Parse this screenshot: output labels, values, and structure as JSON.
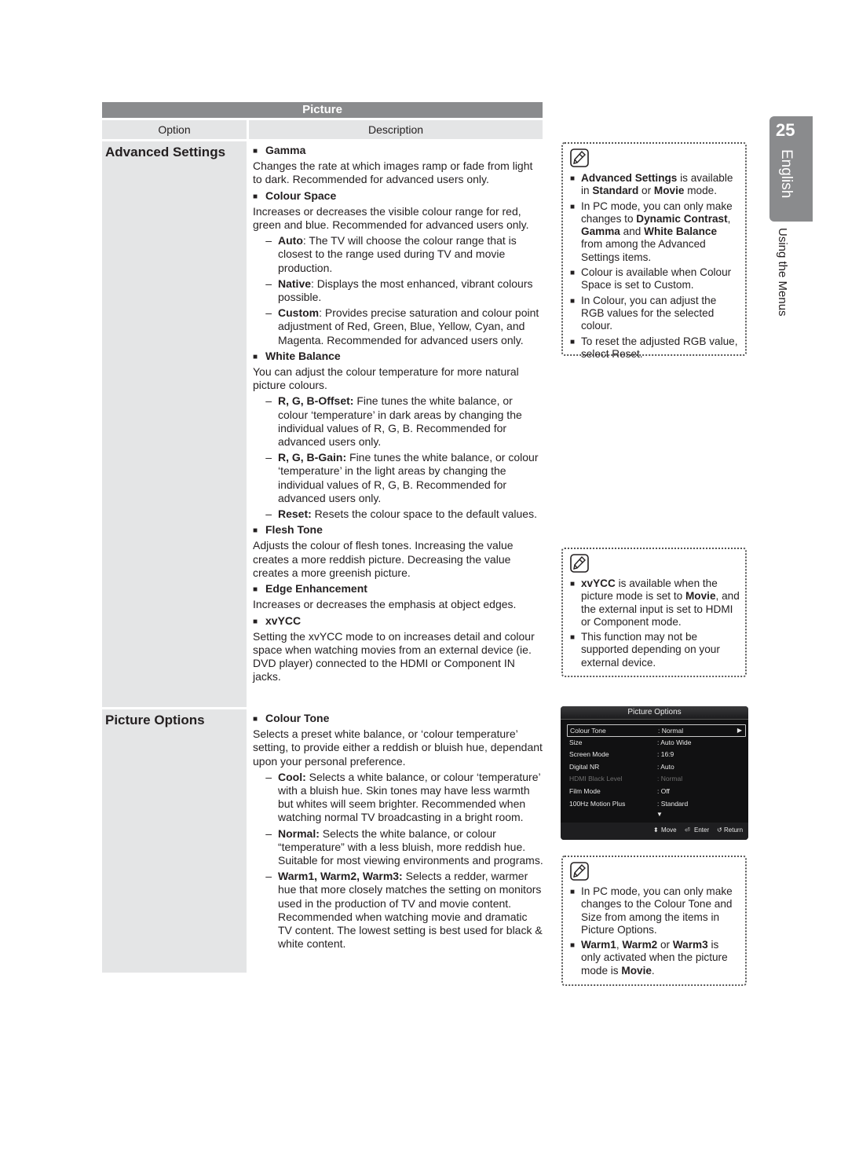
{
  "table": {
    "title": "Picture",
    "col_option": "Option",
    "col_description": "Description"
  },
  "options": [
    {
      "label": "Advanced Settings",
      "items": [
        {
          "title": "Gamma",
          "body": "Changes the rate at which images ramp or fade from light to dark. Recommended for advanced users only.",
          "subs": []
        },
        {
          "title": "Colour Space",
          "body": "Increases or decreases the visible colour range for red, green and blue. Recommended for advanced users only.",
          "subs": [
            {
              "term": "Auto",
              "text": ": The TV will choose the colour range that is closest to the range used during TV and movie production."
            },
            {
              "term": "Native",
              "text": ": Displays the most enhanced, vibrant colours possible."
            },
            {
              "term": "Custom",
              "text": ": Provides precise saturation and colour point adjustment of Red, Green, Blue, Yellow, Cyan, and Magenta. Recommended for advanced users only."
            }
          ]
        },
        {
          "title": "White Balance",
          "body": "You can adjust the colour temperature for more natural picture colours.",
          "subs": [
            {
              "term": "R, G, B-Offset:",
              "text": " Fine tunes the white balance, or colour ‘temperature’ in dark areas by changing the individual values of R, G, B. Recommended for advanced users only."
            },
            {
              "term": "R, G, B-Gain:",
              "text": " Fine tunes the white balance, or colour ‘temperature’ in the light areas by changing the individual values of R, G, B.  Recommended for advanced users only."
            },
            {
              "term": "Reset:",
              "text": " Resets the colour space to the default values."
            }
          ]
        },
        {
          "title": "Flesh Tone",
          "body": "Adjusts the colour of flesh tones. Increasing the value creates a more reddish picture. Decreasing the value creates a more greenish picture.",
          "subs": []
        },
        {
          "title": "Edge Enhancement",
          "body": "Increases or decreases the emphasis at object edges.",
          "subs": []
        },
        {
          "title": "xvYCC",
          "body": "Setting the xvYCC mode to on increases detail and colour space when watching movies from an external device (ie. DVD player) connected to the HDMI or Component IN jacks.",
          "subs": []
        }
      ]
    },
    {
      "label": "Picture Options",
      "items": [
        {
          "title": "Colour Tone",
          "body": "Selects a preset white balance, or ‘colour temperature’ setting, to provide either a reddish or bluish hue, dependant upon your personal preference.",
          "subs": [
            {
              "term": "Cool:",
              "text": " Selects a white balance, or colour ‘temperature’ with a bluish hue. Skin tones may have less warmth but whites will seem brighter. Recommended when watching normal TV broadcasting in a bright room."
            },
            {
              "term": "Normal:",
              "text": " Selects the white balance, or colour “temperature” with a less bluish, more reddish hue. Suitable for most viewing environments and programs."
            },
            {
              "term": "Warm1, Warm2, Warm3:",
              "text": " Selects a redder, warmer hue that more closely matches the setting on monitors used in the production of TV and movie content. Recommended when watching movie and dramatic TV content. The lowest setting is best used for black & white content."
            }
          ]
        }
      ]
    }
  ],
  "notes": [
    {
      "icon": "note-pencil-icon",
      "items": [
        [
          {
            "b": "Advanced Settings"
          },
          {
            "t": " is available in "
          },
          {
            "b": "Standard"
          },
          {
            "t": " or "
          },
          {
            "b": "Movie"
          },
          {
            "t": " mode."
          }
        ],
        [
          {
            "t": "In PC mode, you can only make changes to "
          },
          {
            "b": "Dynamic Contrast"
          },
          {
            "t": ", "
          },
          {
            "b": "Gamma"
          },
          {
            "t": " and "
          },
          {
            "b": "White Balance"
          },
          {
            "t": " from among the Advanced Settings items."
          }
        ],
        [
          {
            "t": "Colour is available when Colour Space is set to Custom."
          }
        ],
        [
          {
            "t": "In Colour, you can adjust the RGB values for the selected colour."
          }
        ],
        [
          {
            "t": "To reset the adjusted RGB value, select Reset."
          }
        ]
      ]
    },
    {
      "icon": "note-pencil-icon",
      "items": [
        [
          {
            "b": "xvYCC"
          },
          {
            "t": " is available when the picture mode is set to "
          },
          {
            "b": "Movie"
          },
          {
            "t": ", and the external input is set to HDMI or Component mode."
          }
        ],
        [
          {
            "t": "This function may not be supported depending on your external device."
          }
        ]
      ]
    },
    {
      "icon": "note-pencil-icon",
      "items": [
        [
          {
            "t": "In PC mode, you can only make changes to the Colour Tone and Size from among the items in Picture Options."
          }
        ],
        [
          {
            "b": "Warm1"
          },
          {
            "t": ", "
          },
          {
            "b": "Warm2"
          },
          {
            "t": " or "
          },
          {
            "b": "Warm3"
          },
          {
            "t": " is only activated when the picture mode is "
          },
          {
            "b": "Movie"
          },
          {
            "t": "."
          }
        ]
      ]
    }
  ],
  "osd": {
    "title": "Picture Options",
    "rows": [
      {
        "key": "Colour Tone",
        "value": ": Normal",
        "selected": true,
        "disabled": false
      },
      {
        "key": "Size",
        "value": ": Auto Wide",
        "selected": false,
        "disabled": false
      },
      {
        "key": "Screen Mode",
        "value": ": 16:9",
        "selected": false,
        "disabled": false
      },
      {
        "key": "Digital NR",
        "value": ": Auto",
        "selected": false,
        "disabled": false
      },
      {
        "key": "HDMI Black Level",
        "value": ": Normal",
        "selected": false,
        "disabled": true
      },
      {
        "key": "Film Mode",
        "value": ": Off",
        "selected": false,
        "disabled": false
      },
      {
        "key": "100Hz Motion Plus",
        "value": ": Standard",
        "selected": false,
        "disabled": false
      }
    ],
    "footer": {
      "move": "Move",
      "enter": "Enter",
      "return": "Return"
    }
  },
  "side": {
    "page_number": "25",
    "language": "English",
    "section": "Using the Menus"
  },
  "colors": {
    "header_gray": "#8a8b8d",
    "cell_gray": "#e4e5e6",
    "osd_bg": "#111112"
  }
}
